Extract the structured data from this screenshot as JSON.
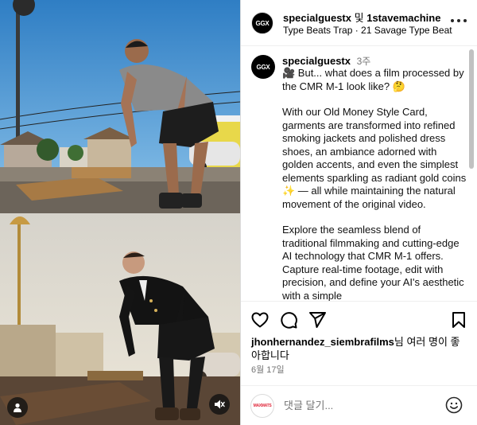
{
  "post": {
    "author": "specialguestx",
    "collab_conjunction": "및",
    "collaborator": "1stavemachine",
    "audio": "Type Beats Trap · 21 Savage Type Beat",
    "avatar_text": "GGX",
    "commenter_avatar_text": "MAXMATS"
  },
  "caption": {
    "username": "specialguestx",
    "time": "3주",
    "paragraphs": [
      "🎥 But... what does a film processed by the CMR M-1 look like? 🤔",
      "With our Old Money Style Card, garments are transformed into refined smoking jackets and polished dress shoes, an ambiance adorned with golden accents, and even the simplest elements sparkling as radiant gold coins ✨ — all while maintaining the natural movement of the original video.",
      "Explore the seamless blend of traditional filmmaking and cutting-edge AI technology that CMR M-1 offers. Capture real-time footage, edit with precision, and define your AI's aesthetic with a simple"
    ]
  },
  "likes": {
    "user": "jhonhernandez_siembrafilms",
    "suffix": "님 여러 명이 좋아합니다"
  },
  "date": "6월 17일",
  "comment": {
    "placeholder": "댓글 달기..."
  },
  "icons": {
    "like": "heart-icon",
    "comment": "comment-bubble-icon",
    "share": "paper-plane-icon",
    "save": "bookmark-icon",
    "more": "more-horizontal-icon",
    "tags": "user-tag-icon",
    "mute": "muted-speaker-icon",
    "emoji": "smiley-icon"
  },
  "colors": {
    "accent_blue": "#0095f6",
    "secondary_text": "#737373",
    "border": "#dbdbdb"
  }
}
